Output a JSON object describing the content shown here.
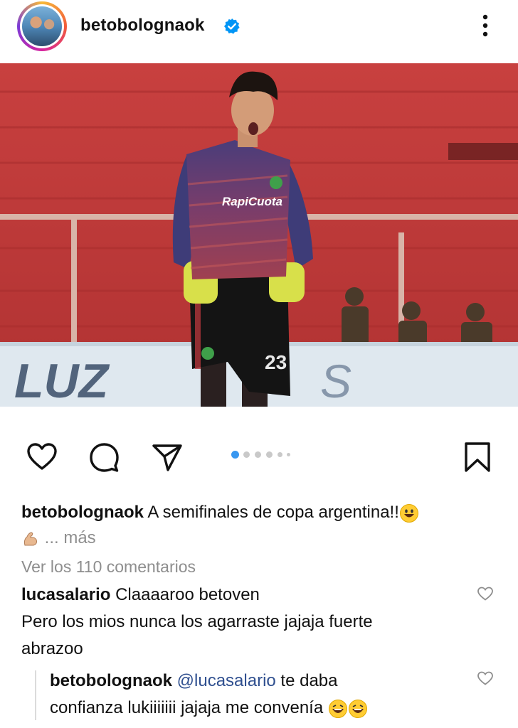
{
  "header": {
    "username": "betobolognaok",
    "verified_icon": "verified-badge-icon",
    "more_icon": "more-vertical-icon"
  },
  "post": {
    "image": "goalkeeper-celebrating-photo",
    "jersey_sponsor": "RapiCuota",
    "jersey_number": "23",
    "board_text": "LUZ"
  },
  "actions": {
    "like_icon": "heart-icon",
    "comment_icon": "comment-icon",
    "share_icon": "send-icon",
    "save_icon": "bookmark-icon",
    "carousel": {
      "total": 6,
      "active": 1
    }
  },
  "caption": {
    "username": "betobolognaok",
    "text": "A semifinales de copa argentina!!",
    "more": "... más"
  },
  "comments_link": "Ver los 110 comentarios",
  "comments": [
    {
      "username": "lucasalario",
      "line1": "Claaaaroo betoven",
      "line2": "Pero los mios nunca los agarraste jajaja fuerte",
      "line3": "abrazoo"
    }
  ],
  "reply": {
    "username": "betobolognaok",
    "mention": "@lucasalario",
    "text1": "te daba",
    "text2": "confianza lukiiiiiii jajaja me convenía"
  },
  "colors": {
    "verified": "#0095f6",
    "carousel_active": "#3897f0",
    "muted_text": "#8e8e8e",
    "mention": "#2f4f8f"
  }
}
